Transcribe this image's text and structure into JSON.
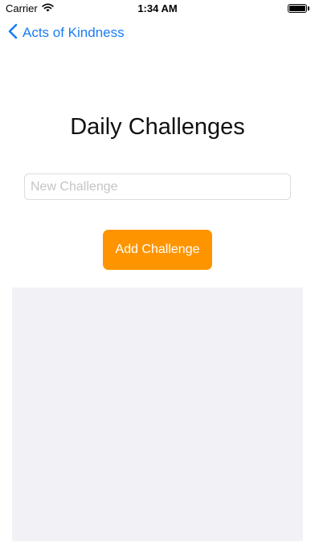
{
  "status_bar": {
    "carrier": "Carrier",
    "time": "1:34 AM",
    "wifi_icon": "wifi-icon",
    "battery_icon": "battery-icon"
  },
  "nav": {
    "back_label": "Acts of Kindness",
    "back_icon": "chevron-left-icon",
    "tint_color": "#1a7cf5"
  },
  "main": {
    "title": "Daily Challenges",
    "input": {
      "value": "",
      "placeholder": "New Challenge"
    },
    "add_button_label": "Add Challenge",
    "accent_color": "#fe9500",
    "list": {
      "items": [],
      "background_color": "#f2f2f6"
    }
  }
}
